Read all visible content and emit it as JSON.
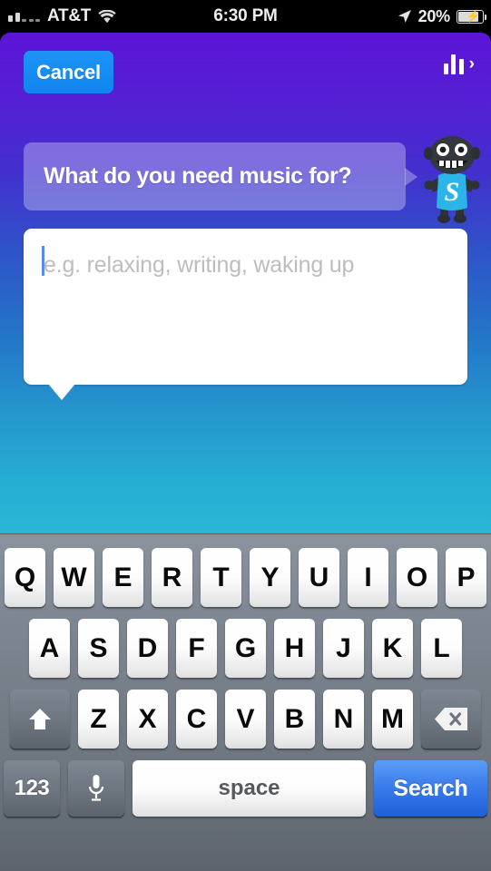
{
  "status_bar": {
    "carrier": "AT&T",
    "time": "6:30 PM",
    "battery_percent": "20%",
    "signal_icon": "signal-bars-icon",
    "wifi_icon": "wifi-icon",
    "location_icon": "location-arrow-icon",
    "battery_icon": "battery-charging-icon"
  },
  "app": {
    "cancel_label": "Cancel",
    "eq_icon": "equalizer-bars-icon",
    "eq_chevron": "›",
    "question": "What do you need music for?",
    "mascot_letter": "S",
    "mascot_name": "robot-mascot"
  },
  "input": {
    "value": "",
    "placeholder": "e.g. relaxing, writing, waking up"
  },
  "keyboard": {
    "row1": [
      "Q",
      "W",
      "E",
      "R",
      "T",
      "Y",
      "U",
      "I",
      "O",
      "P"
    ],
    "row2": [
      "A",
      "S",
      "D",
      "F",
      "G",
      "H",
      "J",
      "K",
      "L"
    ],
    "row3": [
      "Z",
      "X",
      "C",
      "V",
      "B",
      "N",
      "M"
    ],
    "shift_icon": "shift-arrow-icon",
    "backspace_icon": "backspace-icon",
    "numeric_label": "123",
    "mic_icon": "microphone-icon",
    "space_label": "space",
    "search_label": "Search"
  },
  "colors": {
    "gradient_top": "#5c14d6",
    "gradient_mid": "#2474c8",
    "gradient_bottom": "#2bb6d6",
    "cancel_blue": "#1f93f5",
    "search_blue": "#3a7dec",
    "mascot_shirt": "#29b6e8",
    "keyboard_bg": "#7c858f"
  }
}
